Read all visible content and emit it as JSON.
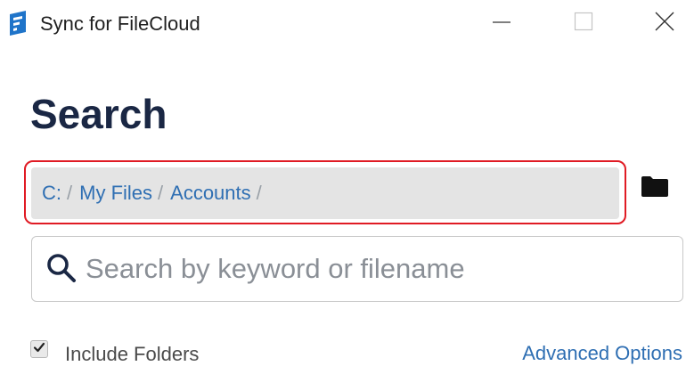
{
  "window": {
    "title": "Sync for FileCloud",
    "app_icon": "filecloud-logo-icon",
    "controls": {
      "minimize_icon": "minimize-icon",
      "maximize_icon": "maximize-icon",
      "close_icon": "close-icon"
    }
  },
  "page": {
    "title": "Search"
  },
  "breadcrumb": {
    "items": [
      {
        "label": "C:",
        "sep": "/"
      },
      {
        "label": "My Files",
        "sep": "/"
      },
      {
        "label": "Accounts",
        "sep": "/"
      }
    ],
    "folder_icon": "folder-icon",
    "highlight_color": "#e01b24"
  },
  "search": {
    "icon": "search-icon",
    "value": "",
    "placeholder": "Search by keyword or filename"
  },
  "options": {
    "include_folders_label": "Include Folders",
    "include_folders_checked": true,
    "advanced_label": "Advanced Options"
  },
  "colors": {
    "link": "#2f6fb3",
    "heading": "#1a2744",
    "breadcrumb_bg": "#e4e4e4"
  }
}
